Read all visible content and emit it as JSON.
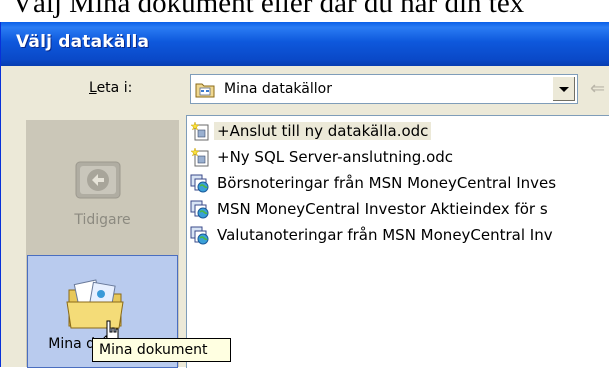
{
  "document": {
    "background_text": "Välj Mina dokument eller där du har din tex"
  },
  "dialog": {
    "title": "Välj datakälla"
  },
  "look_in": {
    "label_underlined": "L",
    "label_rest": "eta i:",
    "value": "Mina datakällor",
    "icon": "data-sources-folder-icon"
  },
  "places": {
    "recent": {
      "label": "Tidigare",
      "icon": "history-icon",
      "disabled": true
    },
    "my_documents": {
      "label": "Mina dokument",
      "icon": "my-documents-folder-icon",
      "selected": true
    }
  },
  "files": [
    {
      "name": "+Anslut till ny datakälla.odc",
      "icon": "new-connection-icon",
      "selected": true
    },
    {
      "name": "+Ny SQL Server-anslutning.odc",
      "icon": "new-connection-icon",
      "selected": false
    },
    {
      "name": "Börsnoteringar från MSN MoneyCentral Inves",
      "icon": "web-query-icon",
      "selected": false
    },
    {
      "name": "MSN MoneyCentral Investor Aktieindex för s",
      "icon": "web-query-icon",
      "selected": false
    },
    {
      "name": "Valutanoteringar från MSN MoneyCentral Inv",
      "icon": "web-query-icon",
      "selected": false
    }
  ],
  "tooltip": {
    "text": "Mina dokument"
  },
  "colors": {
    "titlebar": "#0a49c8",
    "dialog_bg": "#ece9d8",
    "places_bg": "#cbc7b8",
    "selected_place": "#b9cbee",
    "tooltip_bg": "#ffffe1"
  }
}
